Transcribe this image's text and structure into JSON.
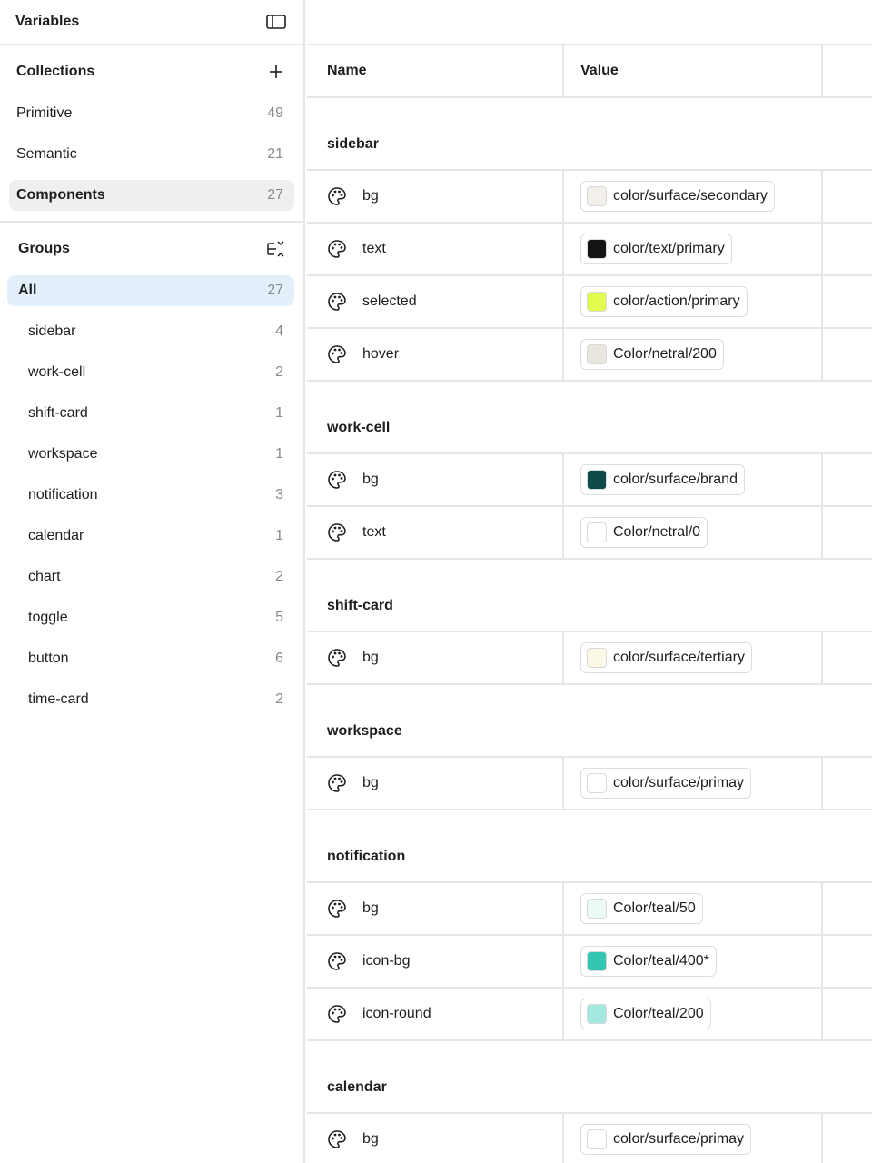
{
  "sidebar": {
    "title": "Variables",
    "toggle_icon": "sidebar-toggle-icon",
    "collections_title": "Collections",
    "add_icon": "plus-icon",
    "collections": [
      {
        "label": "Primitive",
        "count": "49"
      },
      {
        "label": "Semantic",
        "count": "21"
      },
      {
        "label": "Components",
        "count": "27"
      }
    ],
    "groups_title": "Groups",
    "groups_icon": "collapse-list-icon",
    "groups": [
      {
        "label": "All",
        "count": "27"
      },
      {
        "label": "sidebar",
        "count": "4"
      },
      {
        "label": "work-cell",
        "count": "2"
      },
      {
        "label": "shift-card",
        "count": "1"
      },
      {
        "label": "workspace",
        "count": "1"
      },
      {
        "label": "notification",
        "count": "3"
      },
      {
        "label": "calendar",
        "count": "1"
      },
      {
        "label": "chart",
        "count": "2"
      },
      {
        "label": "toggle",
        "count": "5"
      },
      {
        "label": "button",
        "count": "6"
      },
      {
        "label": "time-card",
        "count": "2"
      }
    ]
  },
  "table": {
    "name_header": "Name",
    "value_header": "Value",
    "row_icon": "palette-icon",
    "groups": [
      {
        "title": "sidebar",
        "rows": [
          {
            "name": "bg",
            "value": "color/surface/secondary",
            "color": "#f3f0ec"
          },
          {
            "name": "text",
            "value": "color/text/primary",
            "color": "#141414"
          },
          {
            "name": "selected",
            "value": "color/action/primary",
            "color": "#e3fb4e"
          },
          {
            "name": "hover",
            "value": "Color/netral/200",
            "color": "#e9e6e0"
          }
        ]
      },
      {
        "title": "work-cell",
        "rows": [
          {
            "name": "bg",
            "value": "color/surface/brand",
            "color": "#0f4a4a"
          },
          {
            "name": "text",
            "value": "Color/netral/0",
            "color": "#ffffff"
          }
        ]
      },
      {
        "title": "shift-card",
        "rows": [
          {
            "name": "bg",
            "value": "color/surface/tertiary",
            "color": "#fbf9e6"
          }
        ]
      },
      {
        "title": "workspace",
        "rows": [
          {
            "name": "bg",
            "value": "color/surface/primay",
            "color": "#ffffff"
          }
        ]
      },
      {
        "title": "notification",
        "rows": [
          {
            "name": "bg",
            "value": "Color/teal/50",
            "color": "#ecfaf6"
          },
          {
            "name": "icon-bg",
            "value": "Color/teal/400*",
            "color": "#33c6b0"
          },
          {
            "name": "icon-round",
            "value": "Color/teal/200",
            "color": "#a3e9df"
          }
        ]
      },
      {
        "title": "calendar",
        "rows": [
          {
            "name": "bg",
            "value": "color/surface/primay",
            "color": "#ffffff"
          }
        ]
      }
    ]
  }
}
